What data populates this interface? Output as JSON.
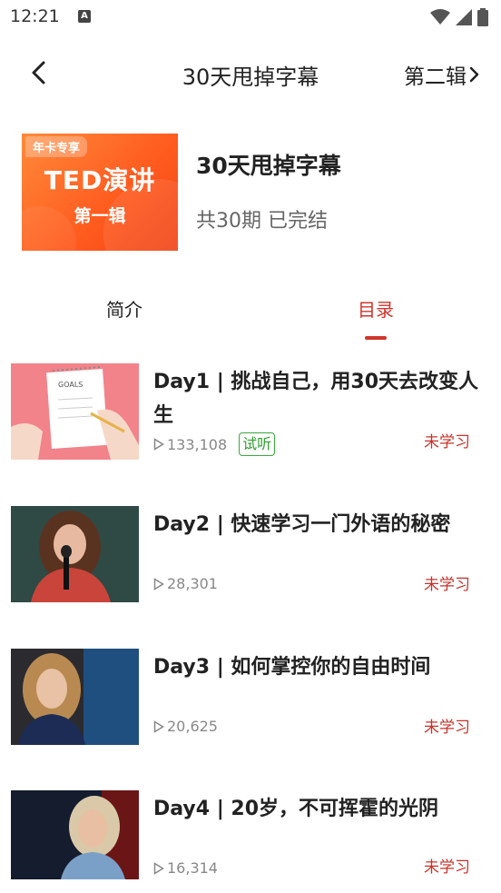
{
  "status_bar": {
    "time": "12:21",
    "notification_icon": "a-icon",
    "icons": [
      "wifi-icon",
      "signal-icon",
      "battery-icon"
    ]
  },
  "header": {
    "title": "30天甩掉字幕",
    "next_album_label": "第二辑",
    "back_icon": "chevron-left-icon",
    "next_icon": "chevron-right-icon"
  },
  "album": {
    "cover_badge": "年卡专享",
    "cover_title": "TED演讲",
    "cover_subtitle": "第一辑",
    "title": "30天甩掉字幕",
    "meta": "共30期 已完结"
  },
  "tabs": [
    {
      "label": "简介",
      "active": false
    },
    {
      "label": "目录",
      "active": true
    }
  ],
  "episodes": [
    {
      "title": "Day1 | 挑战自己，用30天去改变人生",
      "views": "133,108",
      "trial_label": "试听",
      "status": "未学习",
      "thumbnail": "goals-notepad-image"
    },
    {
      "title": "Day2 | 快速学习一门外语的秘密",
      "views": "28,301",
      "status": "未学习",
      "thumbnail": "speaker-woman-red-dress-image"
    },
    {
      "title": "Day3 | 如何掌控你的自由时间",
      "views": "20,625",
      "status": "未学习",
      "thumbnail": "speaker-woman-blue-image"
    },
    {
      "title": "Day4 | 20岁，不可挥霍的光阴",
      "views": "16,314",
      "status": "未学习",
      "thumbnail": "speaker-woman-stage-image"
    }
  ],
  "colors": {
    "accent": "#d0342c",
    "cover_orange": "#ff5a1e",
    "trial_green": "#2f9e2f"
  }
}
